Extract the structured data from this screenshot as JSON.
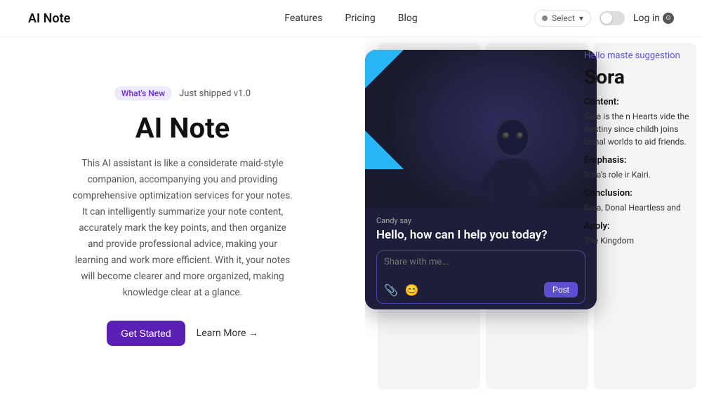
{
  "nav": {
    "logo": "AI Note",
    "links": [
      {
        "label": "Features",
        "id": "features"
      },
      {
        "label": "Pricing",
        "id": "pricing"
      },
      {
        "label": "Blog",
        "id": "blog"
      }
    ],
    "selector_text": "Select",
    "login_label": "Log in"
  },
  "hero": {
    "badge_label": "What's New",
    "badge_subtext": "Just shipped v1.0",
    "title": "AI Note",
    "description": "This AI assistant is like a considerate maid-style companion, accompanying you and providing comprehensive optimization services for your notes. It can intelligently summarize your note content, accurately mark the key points, and then organize and provide professional advice, making your learning and work more efficient. With it, your notes will become clearer and more organized, making knowledge clear at a glance.",
    "get_started": "Get Started",
    "learn_more": "Learn More →"
  },
  "chat": {
    "label": "Candy say",
    "greeting": "Hello, how can I help you today?",
    "input_placeholder": "Share with me...",
    "post_button": "Post"
  },
  "article": {
    "hello_text": "Hello maste suggestion",
    "title": "Sora",
    "content_label": "Content:",
    "content_text": "Sora is the n Hearts vide the Destiny since childh joins Donal worlds to aid friends.",
    "emphasis_label": "Emphasis:",
    "emphasis_text": "Sora's role ir Kairi.",
    "conclusion_label": "Conclusion:",
    "conclusion_text": "Sora, Donal Heartless and",
    "apply_label": "Apply:",
    "apply_text": "The Kingdom"
  }
}
